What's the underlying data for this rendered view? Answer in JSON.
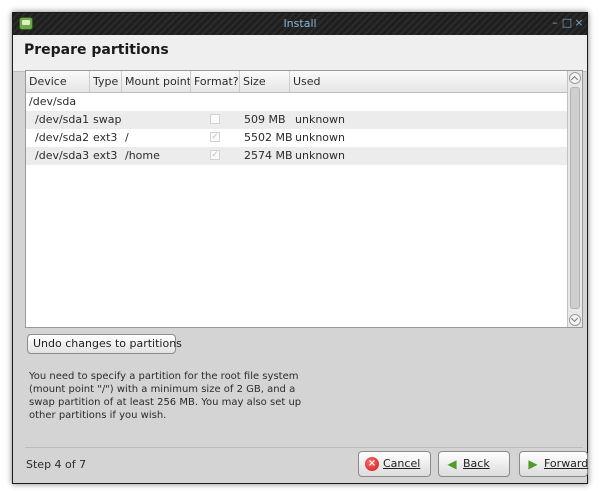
{
  "window": {
    "title": "Install"
  },
  "page": {
    "title": "Prepare partitions"
  },
  "table": {
    "headers": [
      "Device",
      "Type",
      "Mount point",
      "Format?",
      "Size",
      "Used"
    ],
    "disk": "/dev/sda",
    "rows": [
      {
        "device": "/dev/sda1",
        "type": "swap",
        "mount": "",
        "format": false,
        "size": "509 MB",
        "used": "unknown"
      },
      {
        "device": "/dev/sda2",
        "type": "ext3",
        "mount": "/",
        "format": true,
        "size": "5502 MB",
        "used": "unknown"
      },
      {
        "device": "/dev/sda3",
        "type": "ext3",
        "mount": "/home",
        "format": true,
        "size": "2574 MB",
        "used": "unknown"
      }
    ]
  },
  "undo_button": "Undo changes to partitions",
  "info_text": "You need to specify a partition for the root file system (mount point \"/\") with a minimum size of 2 GB, and a swap partition of at least 256 MB. You may also set up other partitions if you wish.",
  "footer": {
    "step": "Step 4 of 7",
    "cancel": "Cancel",
    "back": "Back",
    "forward": "Forward"
  },
  "icons": {
    "app": "installer-app-icon",
    "cancel": "cancel-icon",
    "back": "back-arrow-icon",
    "forward": "forward-arrow-icon"
  }
}
